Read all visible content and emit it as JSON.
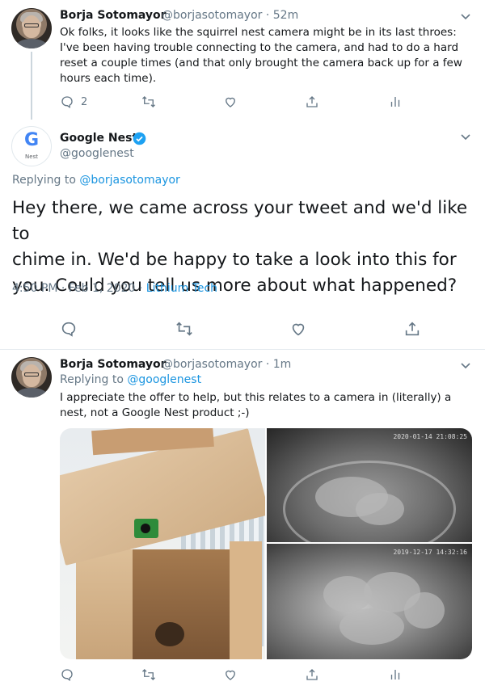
{
  "colors": {
    "accent": "#1b95e0",
    "secondary_text": "#657786",
    "divider": "#e6ecf0",
    "verified": "#1da1f2"
  },
  "tweet1": {
    "name": "Borja Sotomayor",
    "handle_time": "@borjasotomayor · 52m",
    "lines": [
      "Ok folks, it looks like the squirrel nest camera might be in its last throes:",
      "I've been having trouble connecting to the camera, and had to do a hard",
      "reset a couple times (and that only brought the camera back up for a few",
      "hours each time)."
    ],
    "reply_count": "2",
    "icons": [
      "reply-icon",
      "retweet-icon",
      "like-icon",
      "share-icon",
      "analytics-icon"
    ]
  },
  "tweet2": {
    "name": "Google Nest",
    "handle": "@googlenest",
    "avatar_letter": "G",
    "avatar_caption": "Nest",
    "replying_prefix": "Replying to",
    "replying_handle": "@borjasotomayor",
    "lines": [
      "Hey there, we came across your tweet and we'd like to",
      "chime in. We'd be happy to take a look into this for",
      "you. Could you tell us more about what happened?"
    ],
    "timestamp": "4:50 PM · Feb 1, 2020 · ",
    "source": "Lithium Tech",
    "icons": [
      "reply-icon",
      "retweet-icon",
      "like-icon",
      "share-icon"
    ]
  },
  "tweet3": {
    "name": "Borja Sotomayor",
    "handle_time": "@borjasotomayor · 1m",
    "replying_prefix": "Replying to",
    "replying_handle": "@googlenest",
    "lines": [
      "I appreciate the offer to help, but this relates to a camera in (literally) a",
      "nest, not a Google Nest product ;-)"
    ],
    "media": {
      "stamp_top": "2020-01-14 21:08:25",
      "stamp_bottom": "2019-12-17 14:32:16"
    },
    "icons": [
      "reply-icon",
      "retweet-icon",
      "like-icon",
      "share-icon",
      "analytics-icon"
    ]
  }
}
